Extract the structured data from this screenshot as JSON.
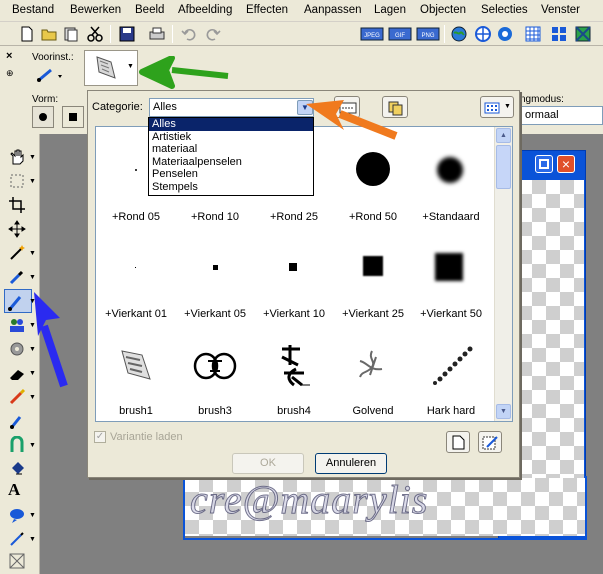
{
  "menu": [
    "Bestand",
    "Bewerken",
    "Beeld",
    "Afbeelding",
    "Effecten",
    "Aanpassen",
    "Lagen",
    "Objecten",
    "Selecties",
    "Venster"
  ],
  "toolbar_icons": [
    "new-file-icon",
    "open-folder-icon",
    "browse-icon",
    "scissors-icon",
    "save-icon",
    "print-icon",
    "undo-icon",
    "redo-icon",
    "jpeg-icon",
    "gif-icon",
    "png-icon",
    "globe-icon",
    "target-icon",
    "image-map-icon",
    "grid-icon",
    "palette-icon",
    "layers-icon"
  ],
  "tool_options": {
    "presets_label": "Voorinst.:",
    "shape_label": "Vorm:",
    "blend_label": "ngmodus:",
    "blend_value": "ormaal"
  },
  "dialog": {
    "category_label": "Categorie:",
    "category_value": "Alles",
    "category_options": [
      "Alles",
      "Artistiek",
      "materiaal",
      "Materiaalpenselen",
      "Penselen",
      "Stempels"
    ],
    "brushes": [
      [
        "+Rond 05",
        "+Rond 10",
        "+Rond 25",
        "+Rond 50",
        "+Standaard"
      ],
      [
        "+Vierkant 01",
        "+Vierkant 05",
        "+Vierkant 10",
        "+Vierkant 25",
        "+Vierkant 50"
      ],
      [
        "brush1",
        "brush3",
        "brush4",
        "Golvend",
        "Hark hard"
      ]
    ],
    "variant_label": "Variantie laden",
    "ok_label": "OK",
    "cancel_label": "Annuleren"
  },
  "watermark": "cre@maarylis",
  "colors": {
    "arrow_green": "#2ea21c",
    "arrow_orange": "#f07a1e",
    "arrow_blue": "#2a2af0",
    "title_blue": "#0a53d8",
    "selection": "#0a246a"
  }
}
